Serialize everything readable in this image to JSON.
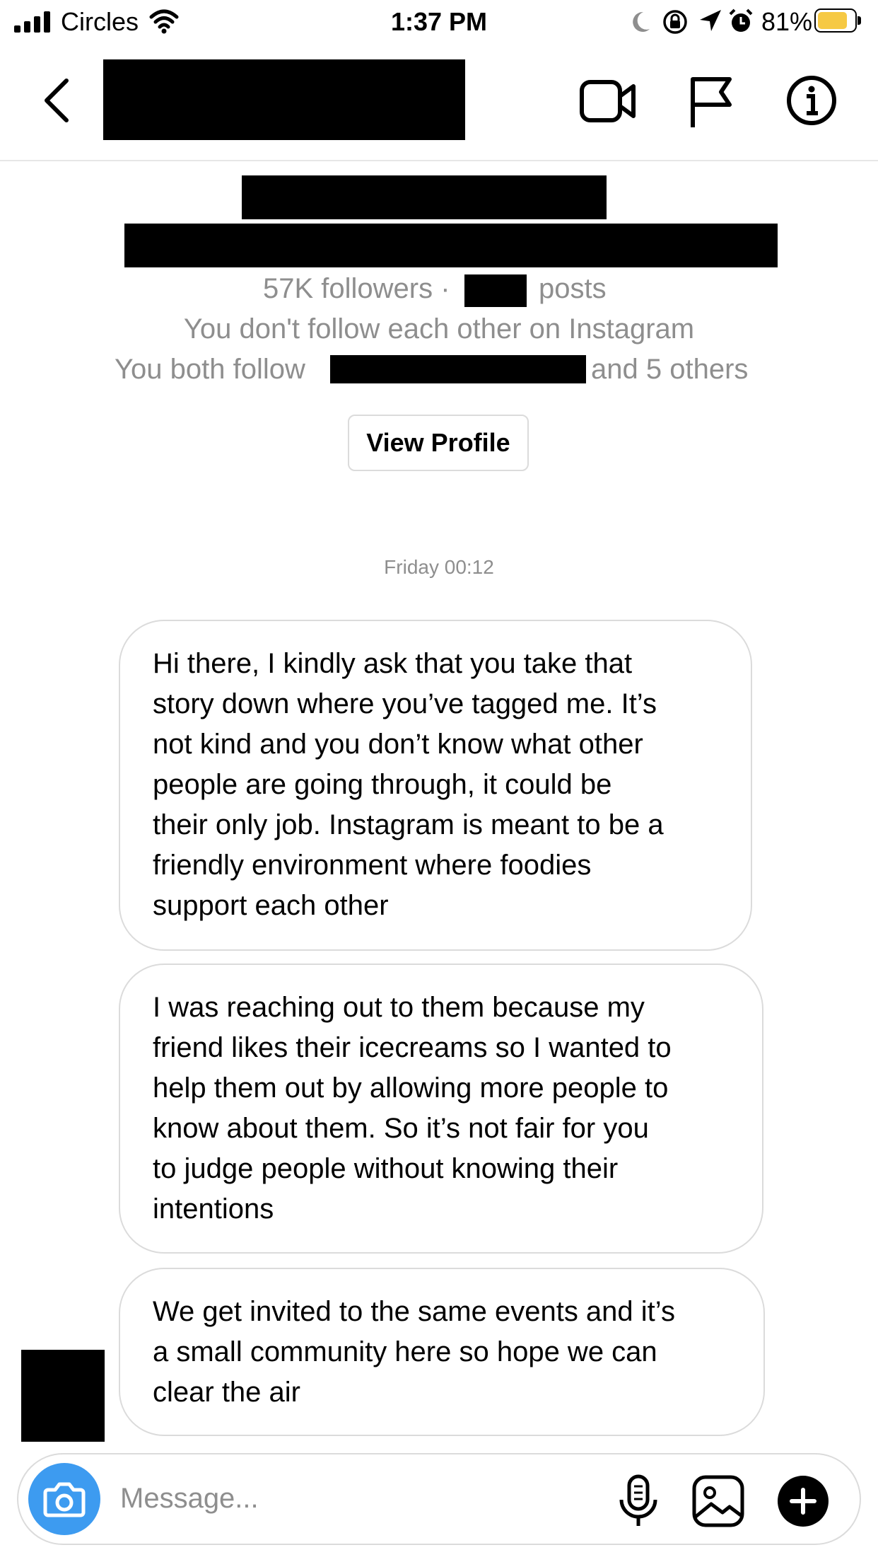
{
  "status_bar": {
    "carrier": "Circles",
    "time": "1:37 PM",
    "battery_percent": "81%",
    "battery_level": 0.81,
    "battery_color": "#f6c944",
    "icons": [
      "signal-bars-icon",
      "wifi-icon",
      "moon-icon",
      "orientation-lock-icon",
      "location-arrow-icon",
      "alarm-clock-icon",
      "battery-icon"
    ]
  },
  "header": {
    "icons": [
      "back-chevron-icon",
      "video-call-icon",
      "flag-icon",
      "info-icon"
    ]
  },
  "profile": {
    "followers_text": "57K followers ·",
    "posts_text": "posts",
    "follow_status": "You don't follow each other on Instagram",
    "mutual_prefix": "You both follow",
    "mutual_suffix": "and 5 others",
    "view_profile_label": "View Profile"
  },
  "thread": {
    "timestamp": "Friday 00:12",
    "messages": [
      {
        "lines": [
          "Hi there, I kindly ask that you take that",
          "story down where you’ve tagged me. It’s",
          "not kind and you don’t know what other",
          "people are going through, it could be",
          "their only job. Instagram is meant to be a",
          "friendly environment where foodies",
          "support each other"
        ]
      },
      {
        "lines": [
          "I was reaching out to them because my",
          "friend likes their icecreams so I wanted to",
          "help them out by allowing more people to",
          "know about them. So it’s not fair for you",
          "to judge people without knowing their",
          "intentions"
        ]
      },
      {
        "lines": [
          "We get invited to the same events and it’s",
          "a small community here so hope we can",
          "clear the air"
        ]
      }
    ]
  },
  "composer": {
    "placeholder": "Message...",
    "camera_color": "#3d9bf0",
    "icons": [
      "camera-icon",
      "microphone-icon",
      "gallery-icon",
      "plus-icon"
    ]
  }
}
